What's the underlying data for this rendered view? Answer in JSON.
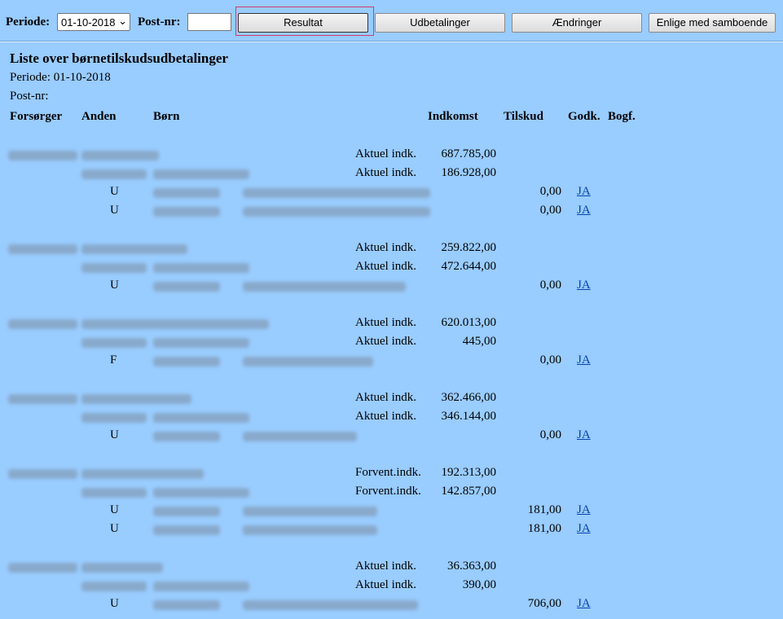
{
  "toolbar": {
    "periode_label": "Periode:",
    "periode_value": "01-10-2018",
    "postnr_label": "Post-nr:",
    "postnr_value": "",
    "btn_resultat": "Resultat",
    "btn_udbetalinger": "Udbetalinger",
    "btn_aendringer": "Ændringer",
    "btn_enlige": "Enlige med samboende"
  },
  "report": {
    "title": "Liste over børnetilskudsudbetalinger",
    "periode": "Periode: 01-10-2018",
    "postnr": "Post-nr:"
  },
  "columns": {
    "forsorger": "Forsørger",
    "anden": "Anden",
    "born": "Børn",
    "indkomst": "Indkomst",
    "tilskud": "Tilskud",
    "godk": "Godk.",
    "bogf": "Bogf."
  },
  "groups": [
    {
      "incomes": [
        {
          "type": "Aktuel indk.",
          "amount": "687.785,00"
        },
        {
          "type": "Aktuel indk.",
          "amount": "186.928,00"
        }
      ],
      "children": [
        {
          "code": "U",
          "tilskud": "0,00",
          "godk": "JA"
        },
        {
          "code": "U",
          "tilskud": "0,00",
          "godk": "JA"
        }
      ]
    },
    {
      "incomes": [
        {
          "type": "Aktuel indk.",
          "amount": "259.822,00"
        },
        {
          "type": "Aktuel indk.",
          "amount": "472.644,00"
        }
      ],
      "children": [
        {
          "code": "U",
          "tilskud": "0,00",
          "godk": "JA"
        }
      ]
    },
    {
      "incomes": [
        {
          "type": "Aktuel indk.",
          "amount": "620.013,00"
        },
        {
          "type": "Aktuel indk.",
          "amount": "445,00"
        }
      ],
      "children": [
        {
          "code": "F",
          "tilskud": "0,00",
          "godk": "JA"
        }
      ]
    },
    {
      "incomes": [
        {
          "type": "Aktuel indk.",
          "amount": "362.466,00"
        },
        {
          "type": "Aktuel indk.",
          "amount": "346.144,00"
        }
      ],
      "children": [
        {
          "code": "U",
          "tilskud": "0,00",
          "godk": "JA"
        }
      ]
    },
    {
      "incomes": [
        {
          "type": "Forvent.indk.",
          "amount": "192.313,00"
        },
        {
          "type": "Forvent.indk.",
          "amount": "142.857,00"
        }
      ],
      "children": [
        {
          "code": "U",
          "tilskud": "181,00",
          "godk": "JA"
        },
        {
          "code": "U",
          "tilskud": "181,00",
          "godk": "JA"
        }
      ]
    },
    {
      "incomes": [
        {
          "type": "Aktuel indk.",
          "amount": "36.363,00"
        },
        {
          "type": "Aktuel indk.",
          "amount": "390,00"
        }
      ],
      "children": [
        {
          "code": "U",
          "tilskud": "706,00",
          "godk": "JA"
        }
      ]
    }
  ]
}
